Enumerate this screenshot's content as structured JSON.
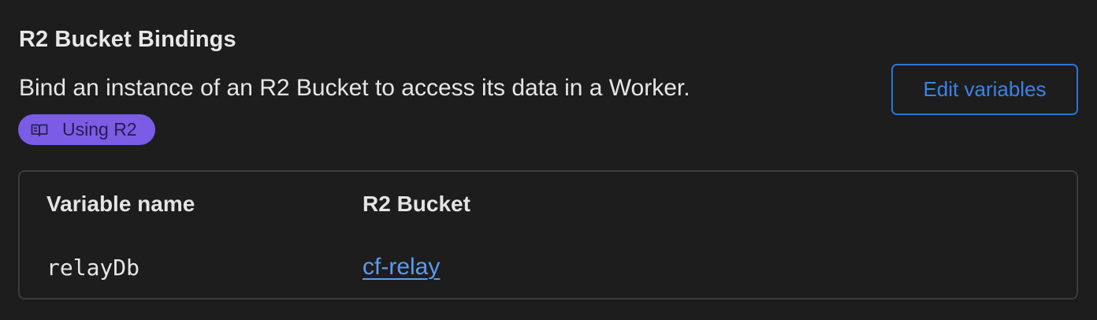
{
  "section": {
    "title": "R2 Bucket Bindings",
    "description": "Bind an instance of an R2 Bucket to access its data in a Worker.",
    "doc_link": {
      "label": "Using R2",
      "icon": "book-icon"
    },
    "edit_button_label": "Edit variables"
  },
  "table": {
    "headers": [
      "Variable name",
      "R2 Bucket"
    ],
    "rows": [
      {
        "variable_name": "relayDb",
        "bucket": "cf-relay"
      }
    ]
  },
  "colors": {
    "background": "#1d1d1d",
    "badge": "#7b5ce6",
    "accent": "#2d73d6",
    "link": "#5a9bf0"
  }
}
